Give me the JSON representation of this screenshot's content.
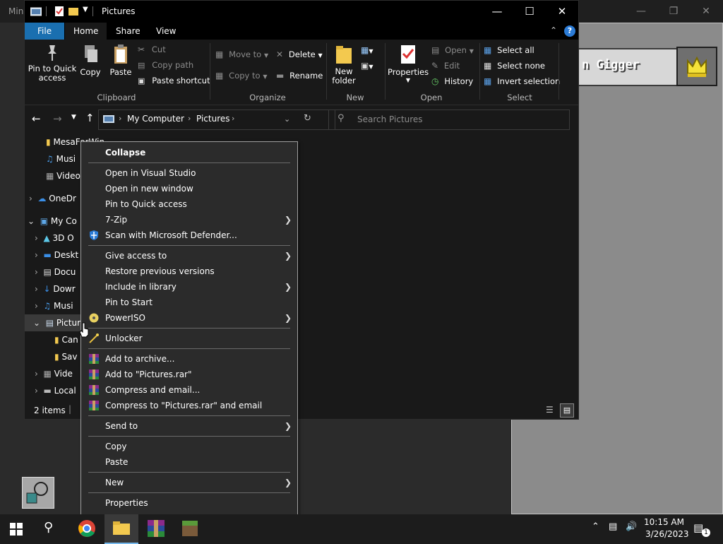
{
  "background_app": {
    "title": "Min",
    "field_text": "n Gigger"
  },
  "explorer": {
    "title": "Pictures",
    "ribbon_tabs": [
      "File",
      "Home",
      "Share",
      "View"
    ],
    "clipboard": {
      "pin": "Pin to Quick access",
      "copy": "Copy",
      "paste": "Paste",
      "cut": "Cut",
      "copy_path": "Copy path",
      "paste_shortcut": "Paste shortcut",
      "group": "Clipboard"
    },
    "organize": {
      "move_to": "Move to",
      "copy_to": "Copy to",
      "delete": "Delete",
      "rename": "Rename",
      "group": "Organize"
    },
    "new": {
      "new_folder": "New folder",
      "group": "New"
    },
    "open": {
      "properties": "Properties",
      "open": "Open",
      "edit": "Edit",
      "history": "History",
      "group": "Open"
    },
    "select": {
      "select_all": "Select all",
      "select_none": "Select none",
      "invert": "Invert selection",
      "group": "Select"
    },
    "address": {
      "crumbs": [
        "My Computer",
        "Pictures"
      ]
    },
    "search_placeholder": "Search Pictures",
    "tree": [
      {
        "label": "MesaForWin",
        "icon": "folder-icon"
      },
      {
        "label": "Musi",
        "icon": "music-icon"
      },
      {
        "label": "Video",
        "icon": "video-icon"
      },
      {
        "label": "OneDr",
        "icon": "cloud-icon"
      },
      {
        "label": "My Co",
        "icon": "computer-icon"
      },
      {
        "label": "3D O",
        "icon": "cube-icon"
      },
      {
        "label": "Deskt",
        "icon": "desktop-icon"
      },
      {
        "label": "Docu",
        "icon": "document-icon"
      },
      {
        "label": "Dowr",
        "icon": "download-icon"
      },
      {
        "label": "Musi",
        "icon": "music-icon"
      },
      {
        "label": "Pictur",
        "icon": "pictures-icon"
      },
      {
        "label": "Can",
        "icon": "folder-icon"
      },
      {
        "label": "Sav",
        "icon": "folder-icon"
      },
      {
        "label": "Vide",
        "icon": "video-icon"
      },
      {
        "label": "Local",
        "icon": "drive-icon"
      }
    ],
    "status": "2 items"
  },
  "context_menu": [
    {
      "label": "Collapse",
      "bold": true
    },
    {
      "sep": true
    },
    {
      "label": "Open in Visual Studio"
    },
    {
      "label": "Open in new window"
    },
    {
      "label": "Pin to Quick access"
    },
    {
      "label": "7-Zip",
      "submenu": true
    },
    {
      "label": "Scan with Microsoft Defender...",
      "icon": "defender-icon"
    },
    {
      "sep": true
    },
    {
      "label": "Give access to",
      "submenu": true
    },
    {
      "label": "Restore previous versions"
    },
    {
      "label": "Include in library",
      "submenu": true
    },
    {
      "label": "Pin to Start"
    },
    {
      "label": "PowerISO",
      "submenu": true,
      "icon": "poweriso-icon"
    },
    {
      "sep": true
    },
    {
      "label": "Unlocker",
      "icon": "unlocker-icon"
    },
    {
      "sep": true
    },
    {
      "label": "Add to archive...",
      "icon": "winrar-icon"
    },
    {
      "label": "Add to \"Pictures.rar\"",
      "icon": "winrar-icon"
    },
    {
      "label": "Compress and email...",
      "icon": "winrar-icon"
    },
    {
      "label": "Compress to \"Pictures.rar\" and email",
      "icon": "winrar-icon"
    },
    {
      "sep": true
    },
    {
      "label": "Send to",
      "submenu": true
    },
    {
      "sep": true
    },
    {
      "label": "Copy"
    },
    {
      "label": "Paste"
    },
    {
      "sep": true
    },
    {
      "label": "New",
      "submenu": true
    },
    {
      "sep": true
    },
    {
      "label": "Properties"
    }
  ],
  "taskbar": {
    "time": "10:15 AM",
    "date": "3/26/2023",
    "notification_count": "1"
  },
  "colors": {
    "accent": "#1a6fb0",
    "menu_bg": "#2b2b2b",
    "explorer_bg": "#191919"
  }
}
